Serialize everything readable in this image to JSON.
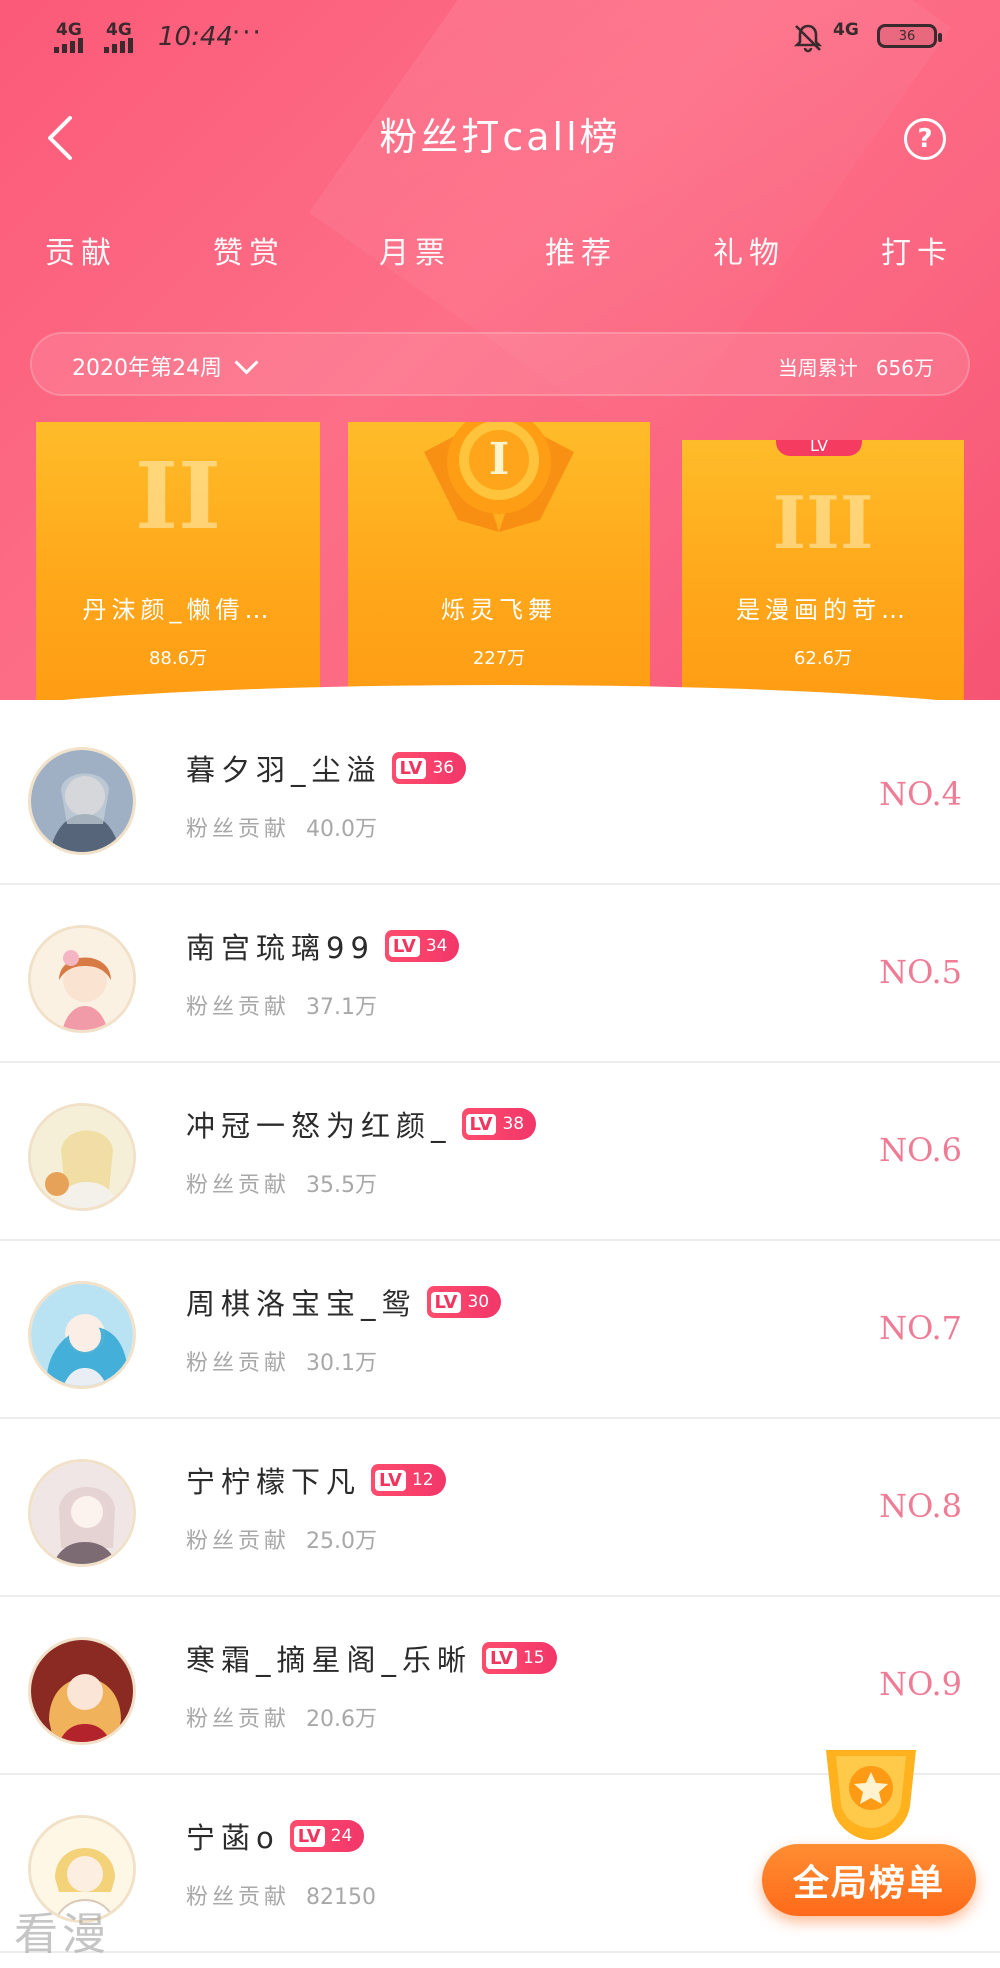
{
  "status_bar": {
    "signal_1": "4G",
    "signal_2": "4G",
    "time": "10:44",
    "more": "···",
    "network": "4G",
    "battery": "36"
  },
  "header": {
    "title": "粉丝打call榜",
    "help": "?"
  },
  "tabs": [
    "贡献",
    "赞赏",
    "月票",
    "推荐",
    "礼物",
    "打卡"
  ],
  "week": {
    "label": "2020年第24周",
    "total_label": "当周累计",
    "total_value": "656万"
  },
  "podium": [
    {
      "rank": "II",
      "name": "丹沫颜_懒倩…",
      "score": "88.6万"
    },
    {
      "rank": "I",
      "name": "烁灵飞舞",
      "score": "227万"
    },
    {
      "rank": "III",
      "name": "是漫画的苛…",
      "score": "62.6万",
      "badge": "LV"
    }
  ],
  "list": [
    {
      "name": "暮夕羽_尘溢",
      "lv": "36",
      "contrib_label": "粉丝贡献",
      "contrib": "40.0万",
      "rank": "NO.4",
      "avatar_color": "#9fb0c4"
    },
    {
      "name": "南宫琉璃99",
      "lv": "34",
      "contrib_label": "粉丝贡献",
      "contrib": "37.1万",
      "rank": "NO.5",
      "avatar_color": "#f1c7a4"
    },
    {
      "name": "冲冠一怒为红颜_",
      "lv": "38",
      "contrib_label": "粉丝贡献",
      "contrib": "35.5万",
      "rank": "NO.6",
      "avatar_color": "#e9d9a6"
    },
    {
      "name": "周棋洛宝宝_鸳",
      "lv": "30",
      "contrib_label": "粉丝贡献",
      "contrib": "30.1万",
      "rank": "NO.7",
      "avatar_color": "#5fb7e0"
    },
    {
      "name": "宁柠檬下凡",
      "lv": "12",
      "contrib_label": "粉丝贡献",
      "contrib": "25.0万",
      "rank": "NO.8",
      "avatar_color": "#ead8d6"
    },
    {
      "name": "寒霜_摘星阁_乐晰",
      "lv": "15",
      "contrib_label": "粉丝贡献",
      "contrib": "20.6万",
      "rank": "NO.9",
      "avatar_color": "#c8573c"
    },
    {
      "name": "宁菡o",
      "lv": "24",
      "contrib_label": "粉丝贡献",
      "contrib": "82150",
      "rank": "",
      "avatar_color": "#f3dfa8"
    }
  ],
  "fab": {
    "label": "全局榜单"
  },
  "watermark": "看漫"
}
